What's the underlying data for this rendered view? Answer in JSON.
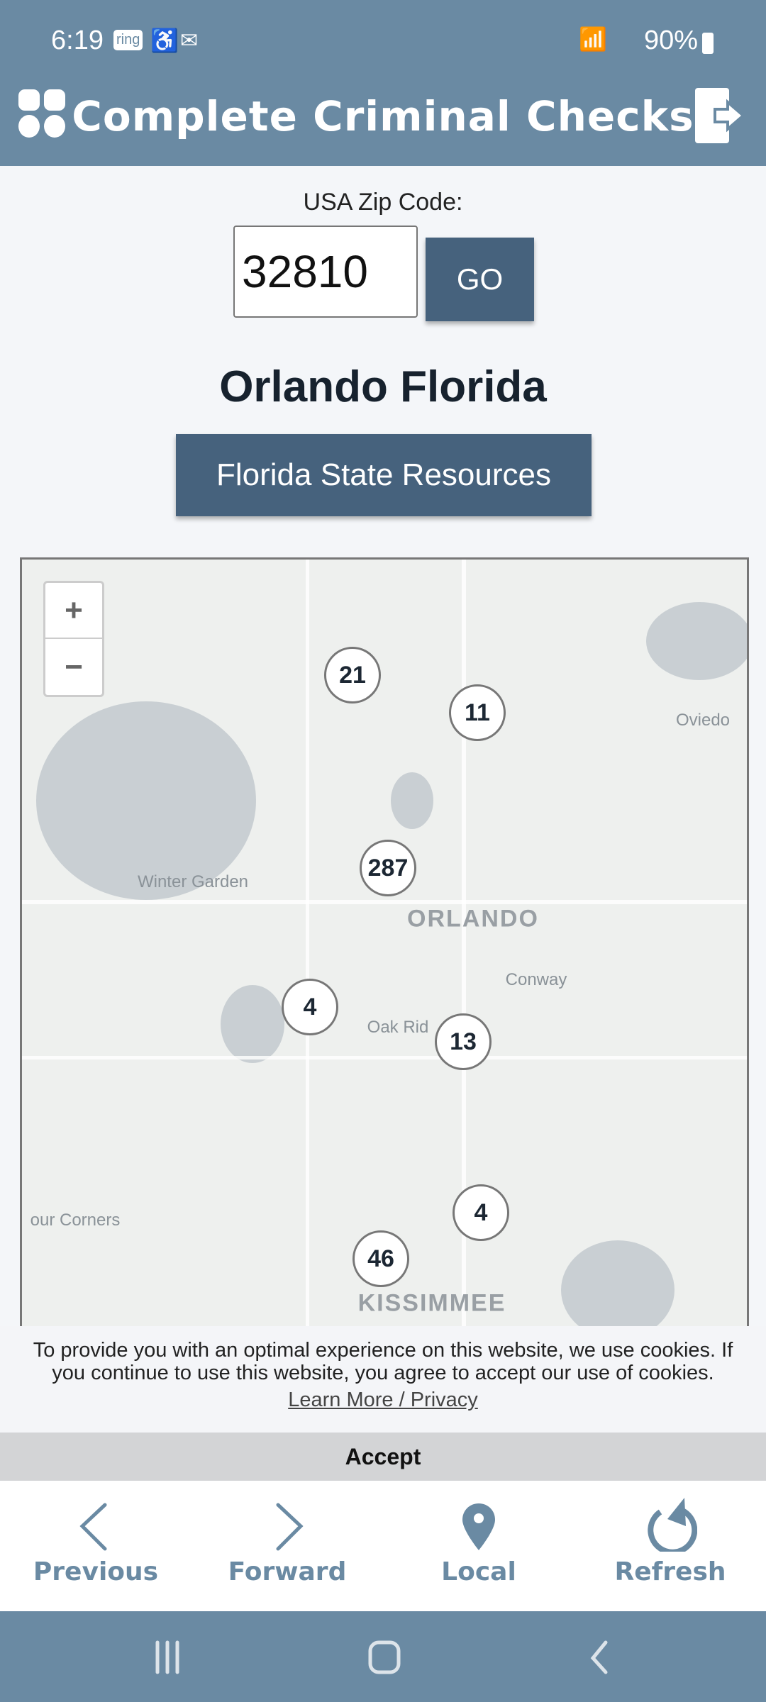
{
  "status_bar": {
    "time": "6:19",
    "notif_ring": "ring",
    "battery": "90%"
  },
  "header": {
    "title": "Complete Criminal Checks",
    "menu_icon": "grid-icon",
    "exit_icon": "logout-icon"
  },
  "zip": {
    "label": "USA Zip Code:",
    "value": "32810",
    "go_label": "GO"
  },
  "city": "Orlando Florida",
  "state_button": "Florida State Resources",
  "map": {
    "zoom_in": "+",
    "zoom_out": "−",
    "labels": [
      "Oviedo",
      "Winter Garden",
      "ORLANDO",
      "Conway",
      "Oak Rid",
      "our Corners",
      "KISSIMMEE"
    ],
    "clusters": [
      "21",
      "11",
      "287",
      "4",
      "13",
      "4",
      "46"
    ]
  },
  "cookie": {
    "text": "To provide you with an optimal experience on this website, we use cookies. If you continue to use this website, you agree to accept our use of cookies.",
    "link": "Learn More / Privacy",
    "accept": "Accept"
  },
  "bottom_nav": [
    {
      "label": "Previous",
      "icon": "chevron-left-icon"
    },
    {
      "label": "Forward",
      "icon": "chevron-right-icon"
    },
    {
      "label": "Local",
      "icon": "map-pin-icon"
    },
    {
      "label": "Refresh",
      "icon": "refresh-icon"
    }
  ],
  "colors": {
    "brand": "#6a8aa3",
    "button": "#46627d"
  }
}
